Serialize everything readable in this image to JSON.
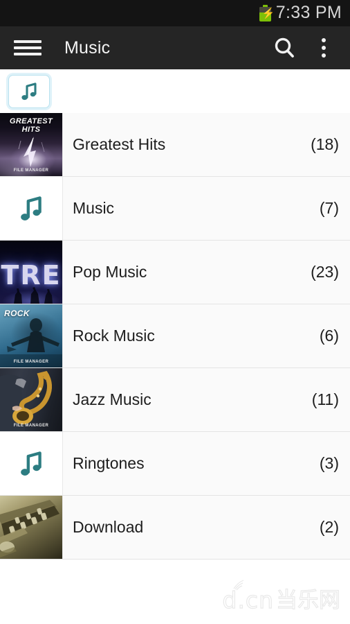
{
  "statusbar": {
    "time": "7:33 PM",
    "battery_icon": "battery-charging-icon",
    "battery_color": "#7ec008"
  },
  "actionbar": {
    "menu_icon": "hamburger-menu-icon",
    "title": "Music",
    "search_icon": "search-icon",
    "overflow_icon": "overflow-menu-icon",
    "background": "#252525"
  },
  "tabs": [
    {
      "icon": "music-note-icon",
      "selected": true,
      "accent": "#dff2f9"
    }
  ],
  "list": {
    "accent_note_color": "#2d7d82",
    "rows": [
      {
        "title": "Greatest Hits",
        "count": "(18)",
        "art": "greatest-hits-album-art",
        "art_label": "GREATEST HITS",
        "art_caption": "FILE MANAGER"
      },
      {
        "title": "Music",
        "count": "(7)",
        "art": "default-music-note-thumbnail",
        "art_label": "",
        "art_caption": ""
      },
      {
        "title": "Pop Music",
        "count": "(23)",
        "art": "pop-music-album-art",
        "art_label": "",
        "art_caption": ""
      },
      {
        "title": "Rock Music",
        "count": "(6)",
        "art": "rock-music-album-art",
        "art_label": "ROCK",
        "art_caption": "FILE MANAGER"
      },
      {
        "title": "Jazz Music",
        "count": "(11)",
        "art": "jazz-music-album-art",
        "art_label": "",
        "art_caption": "FILE MANAGER"
      },
      {
        "title": "Ringtones",
        "count": "(3)",
        "art": "default-music-note-thumbnail",
        "art_label": "",
        "art_caption": ""
      },
      {
        "title": "Download",
        "count": "(2)",
        "art": "download-guitar-art",
        "art_label": "",
        "art_caption": ""
      }
    ]
  },
  "watermark": {
    "latin": "d.cn",
    "chinese": "当乐网"
  }
}
